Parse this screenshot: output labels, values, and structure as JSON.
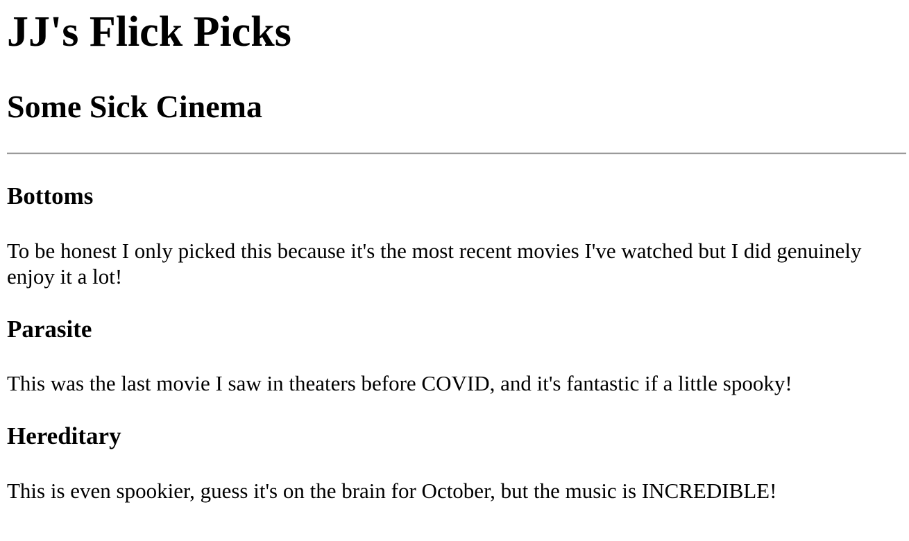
{
  "header": {
    "title": "JJ's Flick Picks",
    "subtitle": "Some Sick Cinema"
  },
  "movies": [
    {
      "title": "Bottoms",
      "description": "To be honest I only picked this because it's the most recent movies I've watched but I did genuinely enjoy it a lot!"
    },
    {
      "title": "Parasite",
      "description": "This was the last movie I saw in theaters before COVID, and it's fantastic if a little spooky!"
    },
    {
      "title": "Hereditary",
      "description": "This is even spookier, guess it's on the brain for October, but the music is INCREDIBLE!"
    }
  ]
}
